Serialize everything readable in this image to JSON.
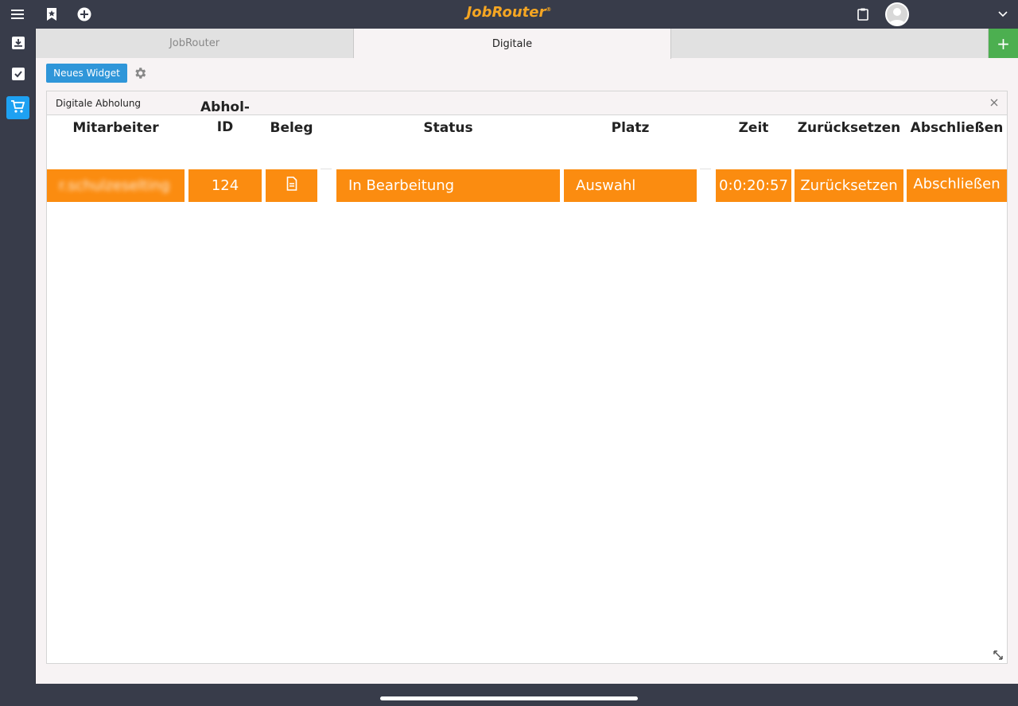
{
  "app": {
    "logo": "JobRouter",
    "logo_mark": "®"
  },
  "tabs": [
    {
      "label": "JobRouter",
      "active": false
    },
    {
      "label": "Digitale",
      "active": true
    },
    {
      "label": "",
      "active": false
    }
  ],
  "toolbar": {
    "new_widget_label": "Neues Widget"
  },
  "widget": {
    "title": "Digitale Abholung",
    "table": {
      "headers": {
        "mitarbeiter": "Mitarbeiter",
        "abhol_id_1": "Abhol-",
        "abhol_id_2": "ID",
        "beleg": "Beleg",
        "status": "Status",
        "platz": "Platz",
        "zeit": "Zeit",
        "zuruecksetzen": "Zurücksetzen",
        "abschliessen": "Abschließen"
      },
      "rows": [
        {
          "mitarbeiter": "r.schulzeselting",
          "abhol_id": "124",
          "status": "In Bearbeitung",
          "platz": "Auswahl",
          "zeit": "0:0:20:57",
          "zuruecksetzen": "Zurücksetzen",
          "abschliessen": "Abschließen"
        }
      ]
    }
  },
  "colors": {
    "topbar": "#383c4a",
    "accent_blue": "#2f96d9",
    "logo": "#f5a623",
    "row_orange": "#fb8c10",
    "add_tab_green": "#4caf50"
  },
  "icons": {
    "topbar": [
      "hamburger-menu-icon",
      "bookmark-star-icon",
      "add-circle-icon",
      "clipboard-icon",
      "chevron-down-icon"
    ],
    "sidebar": [
      "inbox-download-icon",
      "checkbox-inbox-icon",
      "shopping-cart-icon"
    ],
    "widget": [
      "gear-icon",
      "close-icon",
      "resize-icon",
      "document-icon"
    ]
  }
}
